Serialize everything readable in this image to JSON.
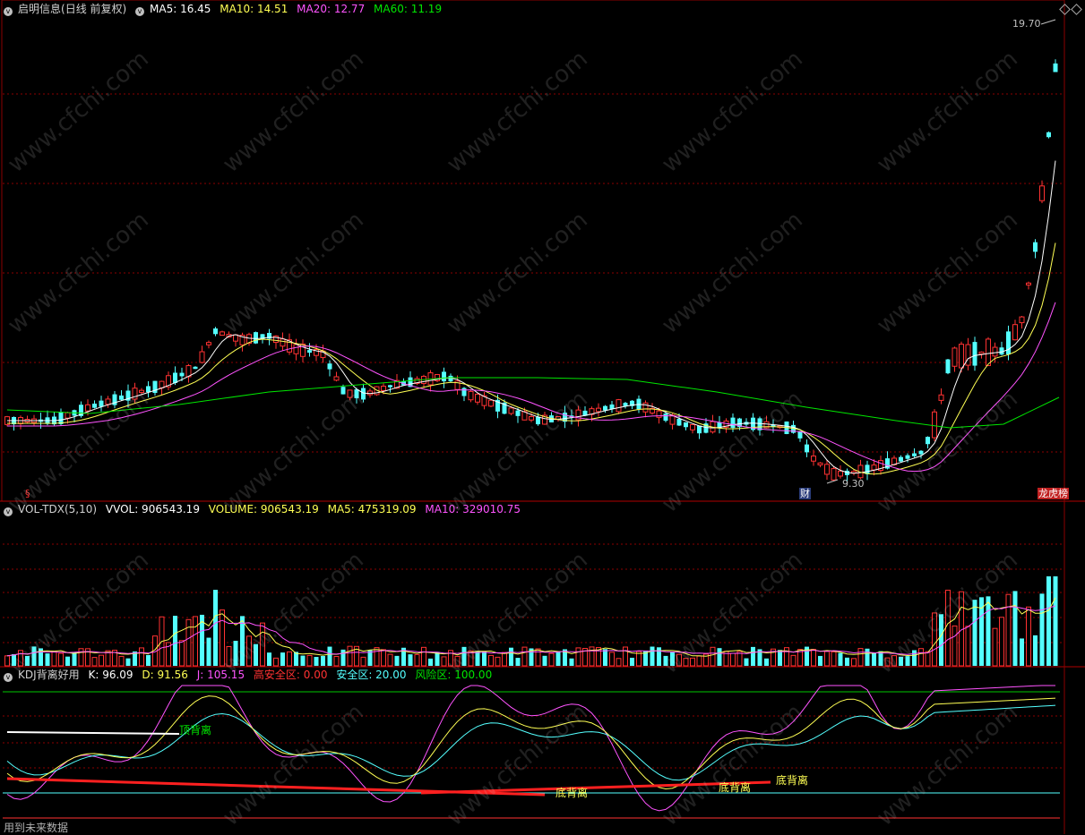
{
  "main": {
    "stock_name": "启明信息",
    "period_label": "(日线 前复权)",
    "ma5": "MA5: 16.45",
    "ma10": "MA10: 14.51",
    "ma20": "MA20: 12.77",
    "ma60": "MA60: 11.19",
    "high_label": "19.70",
    "low_label": "9.30",
    "event_marker_1": "§",
    "event_marker_2": "财",
    "event_marker_3": "龙虎榜"
  },
  "volume": {
    "indicator": "VOL-TDX(5,10)",
    "vvol": "VVOL: 906543.19",
    "volume": "VOLUME: 906543.19",
    "ma5": "MA5: 475319.09",
    "ma10": "MA10: 329010.75"
  },
  "kdj": {
    "indicator": "KDJ背离好用",
    "k": "K: 96.09",
    "d": "D: 91.56",
    "j": "J: 105.15",
    "high_safe": "高安全区: 0.00",
    "safe": "安全区: 20.00",
    "risk": "风险区: 100.00",
    "top_divergence": "顶背离",
    "bottom_divergence_1": "底背离",
    "bottom_divergence_2": "底背离",
    "bottom_divergence_3": "底背离"
  },
  "footer_text": "用到未来数据",
  "watermark": "www.cfchi.com",
  "colors": {
    "background": "#000000",
    "up": "#ff3232",
    "down": "#54ffff",
    "ma5": "#ffffff",
    "ma10": "#ffff54",
    "ma20": "#ff54ff",
    "ma60": "#00e600",
    "grid": "#8b0000"
  }
}
